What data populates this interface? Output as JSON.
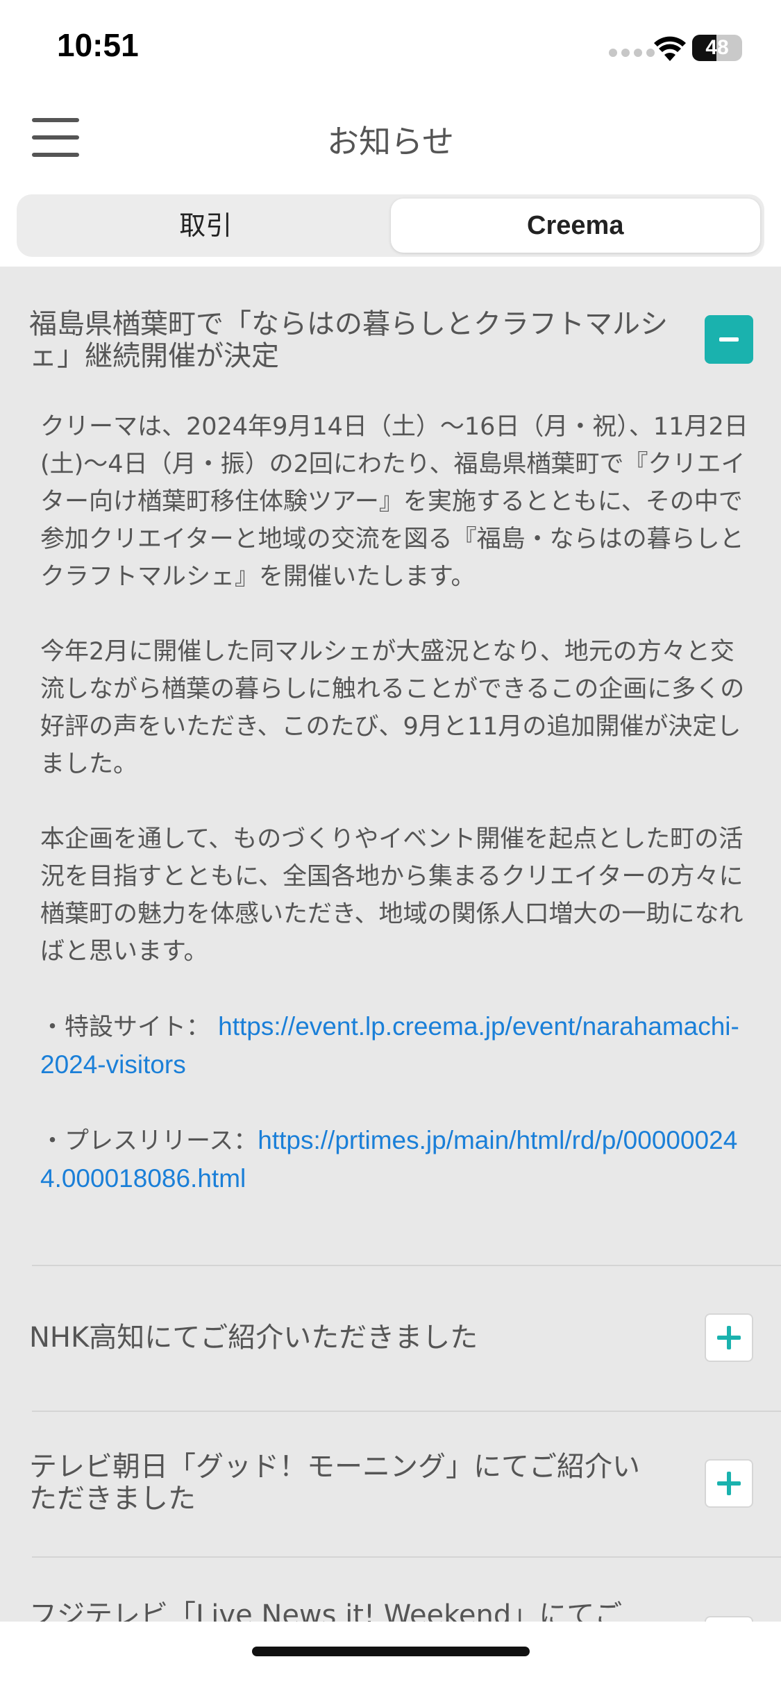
{
  "status_bar": {
    "time": "10:51",
    "battery_level": "48",
    "battery_fraction": 0.48
  },
  "header": {
    "title": "お知らせ",
    "menu_icon": "hamburger-menu-icon"
  },
  "tabs": [
    {
      "label": "取引",
      "active": false
    },
    {
      "label": "Creema",
      "active": true
    }
  ],
  "news": [
    {
      "title": "福島県楢葉町で「ならはの暮らしとクラフトマルシェ」継続開催が決定",
      "expanded": true,
      "body": {
        "p1": "クリーマは、2024年9月14日（土）〜16日（月・祝）、11月2日(土)〜4日（月・振）の2回にわたり、福島県楢葉町で『クリエイター向け楢葉町移住体験ツアー』を実施するとともに、その中で参加クリエイターと地域の交流を図る『福島・ならはの暮らしとクラフトマルシェ』を開催いたします。",
        "p2": "今年2月に開催した同マルシェが大盛況となり、地元の方々と交流しながら楢葉の暮らしに触れることができるこの企画に多くの好評の声をいただき、このたび、9月と11月の追加開催が決定しました。",
        "p3": "本企画を通して、ものづくりやイベント開催を起点とした町の活況を目指すとともに、全国各地から集まるクリエイターの方々に楢葉町の魅力を体感いただき、地域の関係人口増大の一助になればと思います。",
        "link1_label": "・特設サイト：",
        "link1_url": "https://event.lp.creema.jp/event/narahamachi-2024-visitors",
        "link2_label": "・プレスリリース：",
        "link2_url": "https://prtimes.jp/main/html/rd/p/000000244.000018086.html"
      }
    },
    {
      "title": "NHK高知にてご紹介いただきました",
      "expanded": false
    },
    {
      "title": "テレビ朝日「グッド！モーニング」にてご紹介いただきました",
      "expanded": false
    },
    {
      "title": "フジテレビ「Live News it! Weekend」にてご",
      "expanded": false
    }
  ]
}
